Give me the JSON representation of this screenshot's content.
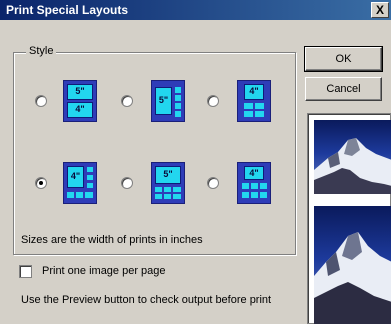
{
  "window": {
    "title": "Print Special Layouts",
    "close_glyph": "X"
  },
  "style_group": {
    "label": "Style"
  },
  "layouts": [
    {
      "id": "a",
      "checked": false,
      "labels": [
        "5\"",
        "4\""
      ]
    },
    {
      "id": "b",
      "checked": false,
      "labels": [
        "5\""
      ]
    },
    {
      "id": "c",
      "checked": false,
      "labels": [
        "4\""
      ]
    },
    {
      "id": "d",
      "checked": true,
      "labels": [
        "4\""
      ]
    },
    {
      "id": "e",
      "checked": false,
      "labels": [
        "5\""
      ]
    },
    {
      "id": "f",
      "checked": false,
      "labels": [
        "4\""
      ]
    }
  ],
  "hint": "Sizes are the width of prints in inches",
  "checkbox": {
    "label": "Print one image per page",
    "checked": false
  },
  "footer": "Use the Preview button to check output before print",
  "buttons": {
    "ok": "OK",
    "cancel": "Cancel"
  },
  "colors": {
    "layout_bg": "#2e3cb8",
    "print_fill": "#22d6ef",
    "title_start": "#0a246a",
    "title_end": "#3a6ea5"
  }
}
